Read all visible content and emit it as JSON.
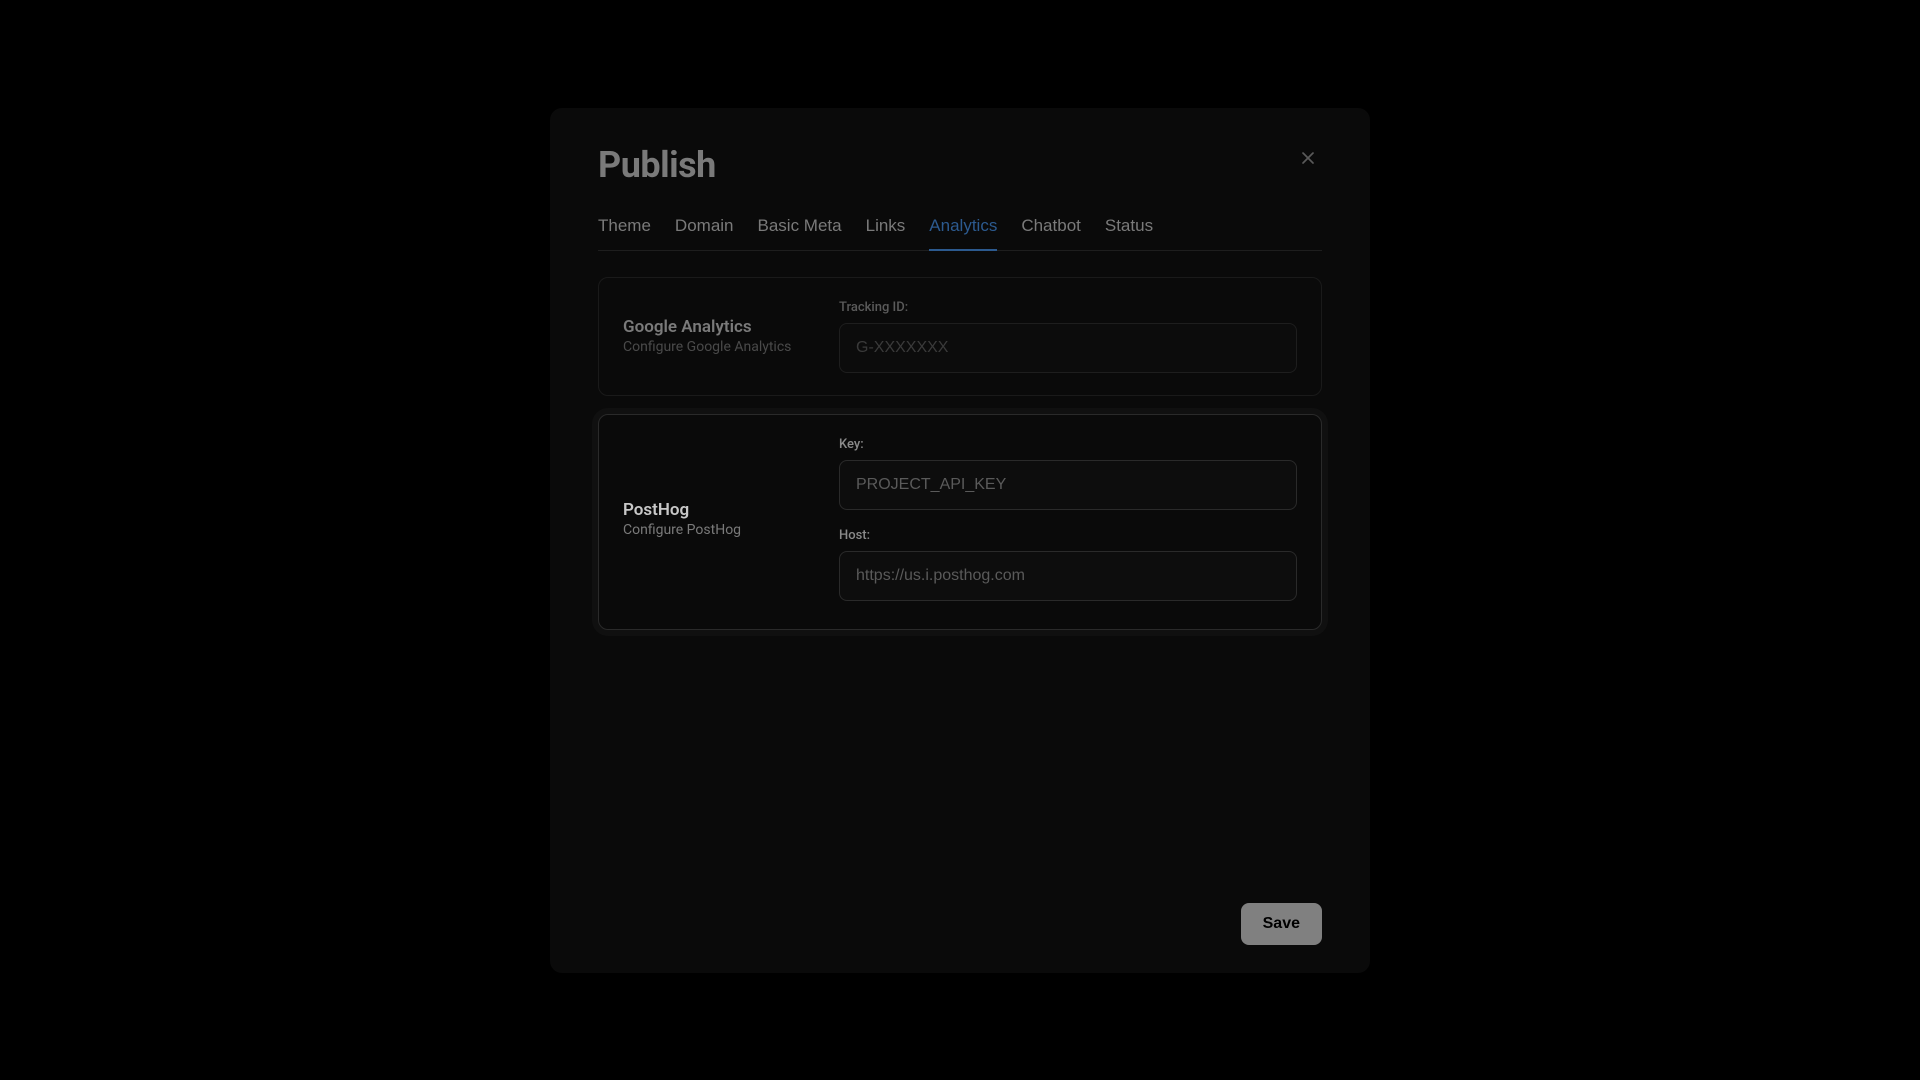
{
  "modal": {
    "title": "Publish"
  },
  "tabs": {
    "theme": "Theme",
    "domain": "Domain",
    "basic_meta": "Basic Meta",
    "links": "Links",
    "analytics": "Analytics",
    "chatbot": "Chatbot",
    "status": "Status"
  },
  "ga": {
    "title": "Google Analytics",
    "subtitle": "Configure Google Analytics",
    "tracking_id_label": "Tracking ID:",
    "tracking_id_placeholder": "G-XXXXXXX"
  },
  "posthog": {
    "title": "PostHog",
    "subtitle": "Configure PostHog",
    "key_label": "Key:",
    "key_placeholder": "PROJECT_API_KEY",
    "host_label": "Host:",
    "host_placeholder": "https://us.i.posthog.com"
  },
  "buttons": {
    "save": "Save"
  }
}
